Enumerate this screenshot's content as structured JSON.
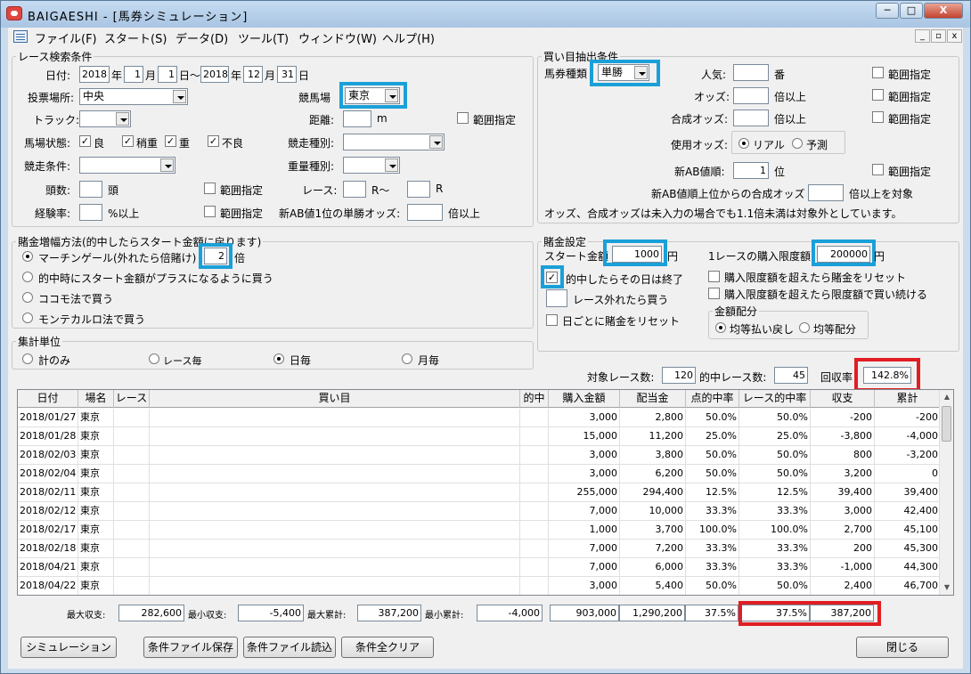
{
  "window": {
    "title": "BAIGAESHI - [馬券シミュレーション]",
    "min": "─",
    "max": "□",
    "close": "X",
    "mdi_min": "_",
    "mdi_restore": "▫",
    "mdi_close": "x"
  },
  "menu": [
    "ファイル(F)",
    "スタート(S)",
    "データ(D)",
    "ツール(T)",
    "ウィンドウ(W)",
    "ヘルプ(H)"
  ],
  "race_search": {
    "legend": "レース検索条件",
    "date_label": "日付:",
    "from_year": "2018",
    "year_label": "年",
    "from_month": "1",
    "month_label": "月",
    "from_day": "1",
    "day_tilde": "日〜",
    "to_year": "2018",
    "to_month": "12",
    "to_day": "31",
    "day_label": "日",
    "venue_label": "投票場所:",
    "venue_value": "中央",
    "course_label": "競馬場",
    "course_value": "東京",
    "track_label": "トラック:",
    "track_value": "",
    "distance_label": "距離:",
    "distance_value": "",
    "distance_unit": "m",
    "distance_range": "範囲指定",
    "condition_label": "馬場状態:",
    "cond1": "良",
    "cond2": "稍重",
    "cond3": "重",
    "cond4": "不良",
    "race_type_label": "競走種別:",
    "race_type_value": "",
    "race_cond_label": "競走条件:",
    "race_cond_value": "",
    "weight_type_label": "重量種別:",
    "weight_type_value": "",
    "heads_label": "頭数:",
    "heads_unit": "頭",
    "heads_range": "範囲指定",
    "race_label": "レース:",
    "race_tilde": "R〜",
    "race_unit": "R",
    "exp_label": "経験率:",
    "exp_unit": "%以上",
    "exp_range": "範囲指定",
    "odds1_label": "新AB値1位の単勝オッズ:",
    "odds1_unit": "倍以上"
  },
  "bet_cond": {
    "legend": "買い目抽出条件",
    "ticket_label": "馬券種類",
    "ticket_value": "単勝",
    "pop_label": "人気:",
    "pop_unit": "番",
    "pop_range": "範囲指定",
    "odds_label": "オッズ:",
    "odds_unit": "倍以上",
    "odds_range": "範囲指定",
    "comp_label": "合成オッズ:",
    "comp_unit": "倍以上",
    "comp_range": "範囲指定",
    "use_odds_label": "使用オッズ:",
    "use_real": "リアル",
    "use_pred": "予測",
    "newab_label": "新AB値順:",
    "newab_value": "1",
    "newab_unit": "位",
    "newab_range": "範囲指定",
    "newab_comp_label": "新AB値順上位からの合成オッズ",
    "newab_comp_unit": "倍以上を対象",
    "note": "オッズ、合成オッズは未入力の場合でも1.1倍未満は対象外としています。"
  },
  "stake_method": {
    "legend": "賭金増幅方法(的中したらスタート金額に戻ります)",
    "opt1": "マーチンゲール(外れたら倍賭け)",
    "opt1_value": "2",
    "opt1_unit": "倍",
    "opt2": "的中時にスタート金額がプラスになるように買う",
    "opt3": "ココモ法で買う",
    "opt4": "モンテカルロ法で買う"
  },
  "stake_setting": {
    "legend": "賭金設定",
    "start_label": "スタート金額",
    "start_value": "1000",
    "start_unit": "円",
    "limit_label": "1レースの購入限度額:",
    "limit_value": "200000",
    "limit_unit": "円",
    "end_on_hit": "的中したらその日は終了",
    "reset_over": "購入限度額を超えたら賭金をリセット",
    "race_miss": "レース外れたら買う",
    "keep_over": "購入限度額を超えたら限度額で買い続ける",
    "reset_daily": "日ごとに賭金をリセット",
    "alloc_legend": "金額配分",
    "alloc1": "均等払い戻し",
    "alloc2": "均等配分"
  },
  "aggregate": {
    "legend": "集計単位",
    "o1": "計のみ",
    "o2": "レース毎",
    "o3": "日毎",
    "o4": "月毎"
  },
  "stats": {
    "target_label": "対象レース数:",
    "target_value": "120",
    "hit_label": "的中レース数:",
    "hit_value": "45",
    "rate_label": "回収率",
    "rate_value": "142.8%"
  },
  "table": {
    "headers": [
      "日付",
      "場名",
      "レース",
      "買い目",
      "的中",
      "購入金額",
      "配当金",
      "点的中率",
      "レース的中率",
      "収支",
      "累計"
    ],
    "rows": [
      [
        "2018/01/27",
        "東京",
        "",
        "",
        "",
        "3,000",
        "2,800",
        "50.0%",
        "50.0%",
        "-200",
        "-200"
      ],
      [
        "2018/01/28",
        "東京",
        "",
        "",
        "",
        "15,000",
        "11,200",
        "25.0%",
        "25.0%",
        "-3,800",
        "-4,000"
      ],
      [
        "2018/02/03",
        "東京",
        "",
        "",
        "",
        "3,000",
        "3,800",
        "50.0%",
        "50.0%",
        "800",
        "-3,200"
      ],
      [
        "2018/02/04",
        "東京",
        "",
        "",
        "",
        "3,000",
        "6,200",
        "50.0%",
        "50.0%",
        "3,200",
        "0"
      ],
      [
        "2018/02/11",
        "東京",
        "",
        "",
        "",
        "255,000",
        "294,400",
        "12.5%",
        "12.5%",
        "39,400",
        "39,400"
      ],
      [
        "2018/02/12",
        "東京",
        "",
        "",
        "",
        "7,000",
        "10,000",
        "33.3%",
        "33.3%",
        "3,000",
        "42,400"
      ],
      [
        "2018/02/17",
        "東京",
        "",
        "",
        "",
        "1,000",
        "3,700",
        "100.0%",
        "100.0%",
        "2,700",
        "45,100"
      ],
      [
        "2018/02/18",
        "東京",
        "",
        "",
        "",
        "7,000",
        "7,200",
        "33.3%",
        "33.3%",
        "200",
        "45,300"
      ],
      [
        "2018/04/21",
        "東京",
        "",
        "",
        "",
        "7,000",
        "6,000",
        "33.3%",
        "33.3%",
        "-1,000",
        "44,300"
      ],
      [
        "2018/04/22",
        "東京",
        "",
        "",
        "",
        "3,000",
        "5,400",
        "50.0%",
        "50.0%",
        "2,400",
        "46,700"
      ]
    ]
  },
  "summary": {
    "max_label": "最大収支:",
    "max_value": "282,600",
    "min_label": "最小収支:",
    "min_value": "-5,400",
    "maxcum_label": "最大累計:",
    "maxcum_value": "387,200",
    "mincum_label": "最小累計:",
    "mincum_value": "-4,000",
    "buy_total": "903,000",
    "pay_total": "1,290,200",
    "hit_total": "37.5%",
    "race_hit_total": "37.5%",
    "cum_total": "387,200"
  },
  "buttons": {
    "simulate": "シミュレーション",
    "save": "条件ファイル保存",
    "load": "条件ファイル読込",
    "clear": "条件全クリア",
    "close": "閉じる"
  }
}
